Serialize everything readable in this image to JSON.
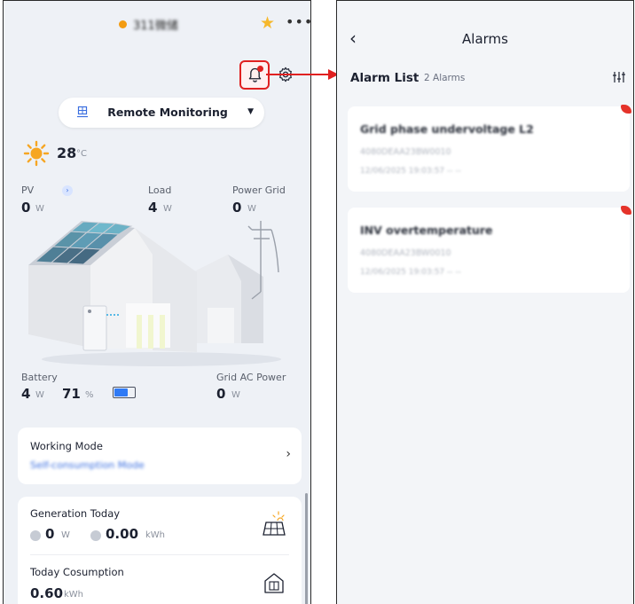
{
  "left_screen": {
    "header": {
      "station_name": "311微储",
      "star_icon": "star-icon",
      "more_icon": "more-icon"
    },
    "mode_select": {
      "label": "Remote Monitoring"
    },
    "weather": {
      "temperature": "28",
      "unit": "°C"
    },
    "energy_flow": {
      "pv": {
        "label": "PV",
        "value": "0",
        "unit": "W"
      },
      "load": {
        "label": "Load",
        "value": "4",
        "unit": "W"
      },
      "grid": {
        "label": "Power Grid",
        "value": "0",
        "unit": "W"
      },
      "battery": {
        "label": "Battery",
        "power": "4",
        "power_unit": "W",
        "soc": "71",
        "soc_unit": "%",
        "soc_fraction": 0.71
      },
      "grid_ac": {
        "label": "Grid AC Power",
        "value": "0",
        "unit": "W"
      }
    },
    "working_mode": {
      "title": "Working Mode",
      "value": "Self-consumption Mode"
    },
    "generation_today": {
      "title": "Generation Today",
      "value_a": "0",
      "unit_a": "W",
      "value_b": "0.00",
      "unit_b": "kWh"
    },
    "today_consumption": {
      "title": "Today Cosumption",
      "value": "0.60",
      "unit": "kWh"
    }
  },
  "right_screen": {
    "title": "Alarms",
    "list_title": "Alarm List",
    "alarm_count": "2 Alarms",
    "alarms": [
      {
        "title": "Grid phase undervoltage L2",
        "sn": "4080DEAA23BW0010",
        "time": "12/06/2025 19:03:57 -- --"
      },
      {
        "title": "INV overtemperature",
        "sn": "4080DEAA23BW0010",
        "time": "12/06/2025 19:03:57 -- --"
      }
    ]
  },
  "colors": {
    "accent_blue": "#3b6fe0",
    "highlight_red": "#e02020",
    "alarm_red": "#e5332a",
    "sun_orange": "#f6a623"
  }
}
